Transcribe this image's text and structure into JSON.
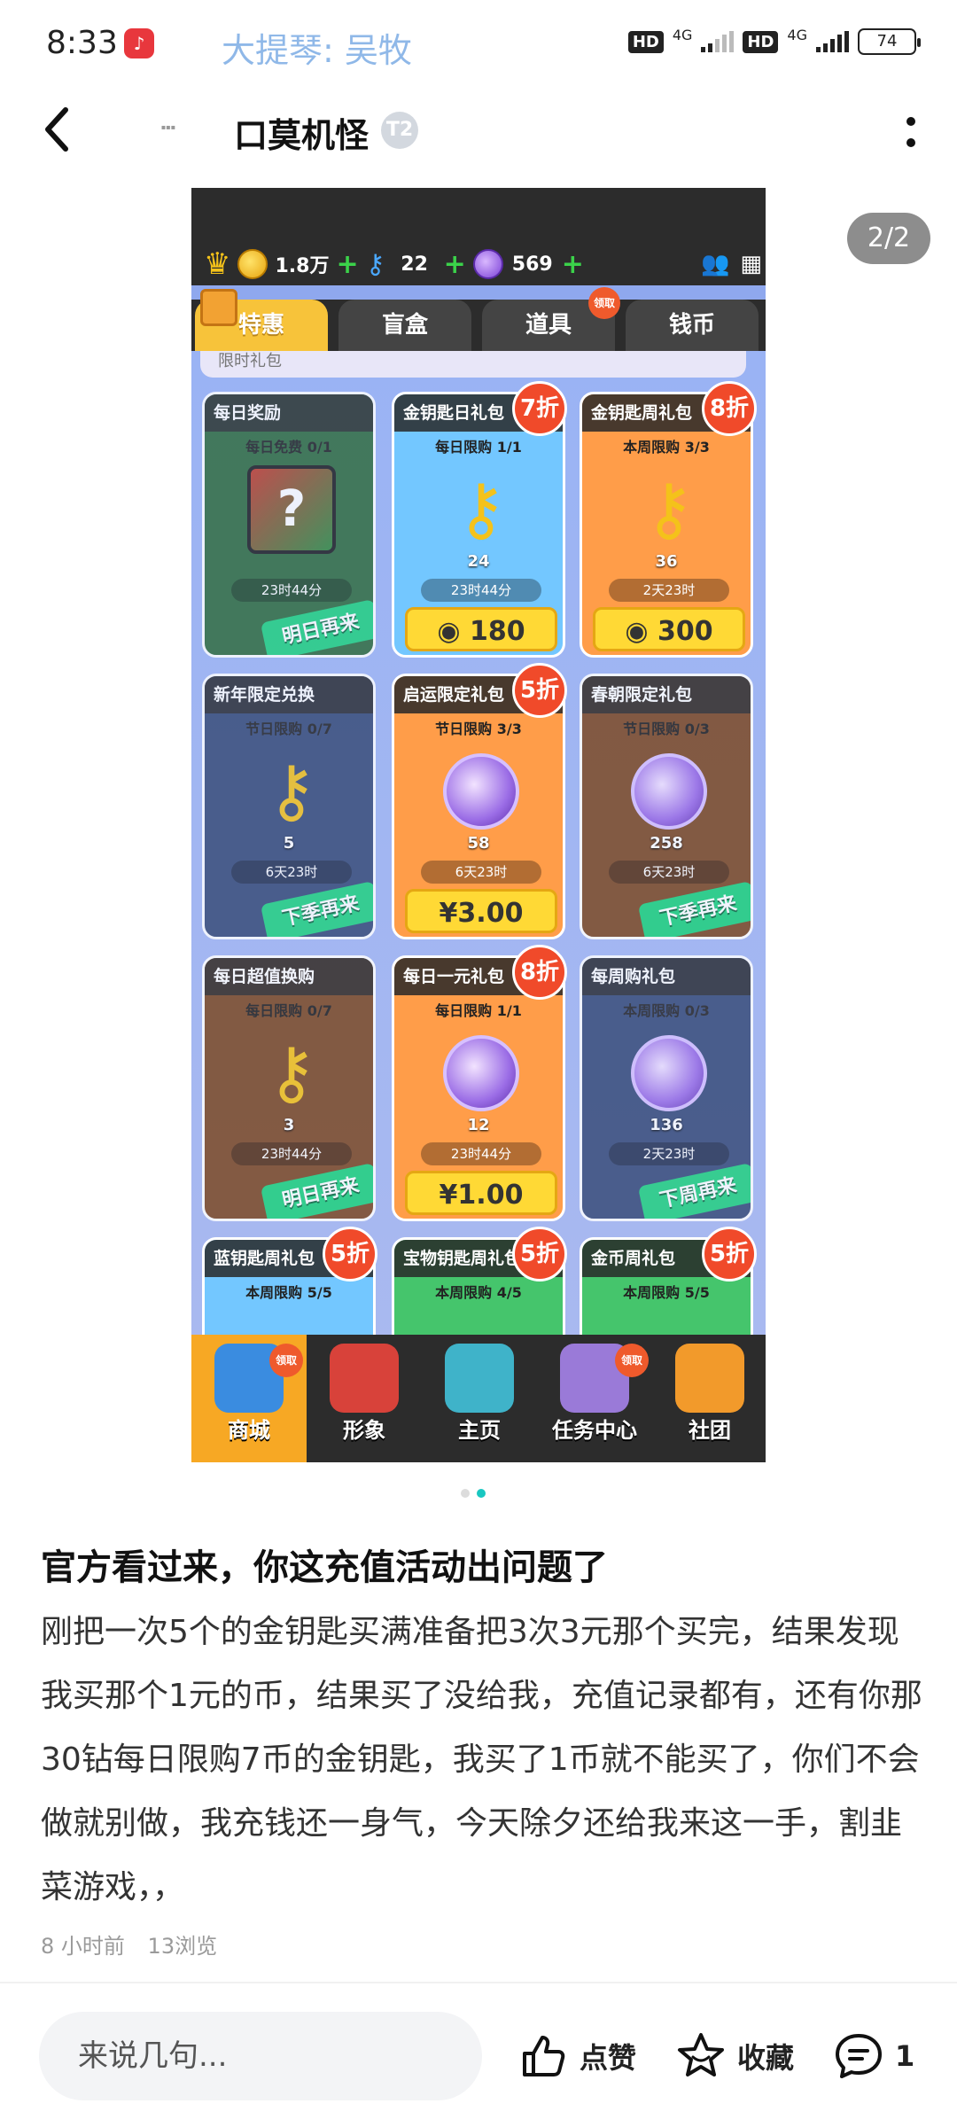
{
  "status_bar": {
    "time": "8:33",
    "music": "大提琴: 吴牧",
    "hd1": "HD",
    "net1": "4G",
    "hd2": "HD",
    "net2": "4G",
    "battery": "74"
  },
  "header": {
    "user_name": "口莫机怪",
    "level_badge": "T2"
  },
  "image_counter": "2/2",
  "game": {
    "resources": {
      "coins": "1.8万",
      "keys": "22",
      "gems": "569"
    },
    "tabs": [
      {
        "label": "特惠"
      },
      {
        "label": "盲盒"
      },
      {
        "label": "道具",
        "badge": "领取"
      },
      {
        "label": "钱币"
      }
    ],
    "section_strip": "限时礼包",
    "cards": [
      {
        "title": "每日奖励",
        "limit": "每日免费 0/1",
        "timer": "23时44分",
        "stamp": "明日再来"
      },
      {
        "title": "金钥匙日礼包",
        "limit": "每日限购 1/1",
        "qty": "24",
        "timer": "23时44分",
        "price": "180",
        "discount": "7折"
      },
      {
        "title": "金钥匙周礼包",
        "limit": "本周限购 3/3",
        "qty": "36",
        "timer": "2天23时",
        "price": "300",
        "discount": "8折"
      },
      {
        "title": "新年限定兑换",
        "limit": "节日限购 0/7",
        "qty": "5",
        "timer": "6天23时",
        "stamp": "下季再来"
      },
      {
        "title": "启运限定礼包",
        "limit": "节日限购 3/3",
        "qty": "58",
        "timer": "6天23时",
        "price": "¥3.00",
        "discount": "5折"
      },
      {
        "title": "春朝限定礼包",
        "limit": "节日限购 0/3",
        "qty": "258",
        "timer": "6天23时",
        "stamp": "下季再来"
      },
      {
        "title": "每日超值换购",
        "limit": "每日限购 0/7",
        "qty": "3",
        "timer": "23时44分",
        "stamp": "明日再来"
      },
      {
        "title": "每日一元礼包",
        "limit": "每日限购 1/1",
        "qty": "12",
        "timer": "23时44分",
        "price": "¥1.00",
        "discount": "8折"
      },
      {
        "title": "每周购礼包",
        "limit": "本周限购 0/3",
        "qty": "136",
        "timer": "2天23时",
        "stamp": "下周再来"
      },
      {
        "title": "蓝钥匙周礼包",
        "limit": "本周限购 5/5",
        "discount": "5折"
      },
      {
        "title": "宝物钥匙周礼包",
        "limit": "本周限购 4/5",
        "discount": "5折"
      },
      {
        "title": "金币周礼包",
        "limit": "本周限购 5/5",
        "discount": "5折"
      }
    ],
    "bottom_nav": [
      {
        "label": "商城",
        "badge": "领取"
      },
      {
        "label": "形象"
      },
      {
        "label": "主页"
      },
      {
        "label": "任务中心",
        "badge": "领取"
      },
      {
        "label": "社团"
      }
    ]
  },
  "post": {
    "title": "官方看过来，你这充值活动出问题了",
    "body": "刚把一次5个的金钥匙买满准备把3次3元那个买完，结果发现我买那个1元的币，结果买了没给我，充值记录都有，还有你那30钻每日限购7币的金钥匙，我买了1币就不能买了，你们不会做就别做，我充钱还一身气，今天除夕还给我来这一手，割韭菜游戏，，",
    "time_ago": "8 小时前",
    "views": "13浏览"
  },
  "bottom_bar": {
    "comment_placeholder": "来说几句...",
    "like_label": "点赞",
    "fav_label": "收藏",
    "comment_count": "1"
  }
}
